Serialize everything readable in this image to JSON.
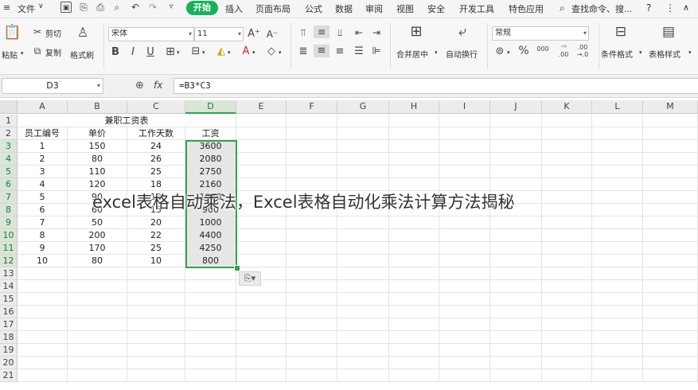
{
  "menubar": {
    "file_label": "文件",
    "tabs": [
      "开始",
      "插入",
      "页面布局",
      "公式",
      "数据",
      "审阅",
      "视图",
      "安全",
      "开发工具",
      "特色应用"
    ],
    "active_tab": "开始",
    "search_label": "查找命令、搜...",
    "help_icon": "?"
  },
  "ribbon": {
    "paste_label": "粘贴",
    "cut_label": "剪切",
    "copy_label": "复制",
    "format_painter_label": "格式刷",
    "font_name": "宋体",
    "font_size": "11",
    "number_format": "常规",
    "merge_center_label": "合并居中",
    "wrap_text_label": "自动换行",
    "conditional_format_label": "条件格式",
    "table_style_label": "表格样式",
    "percent_symbol": "%",
    "thousands_symbol": "000"
  },
  "formula_bar": {
    "name_box": "D3",
    "fx_label": "fx",
    "formula": "=B3*C3"
  },
  "grid": {
    "columns": [
      "A",
      "B",
      "C",
      "D",
      "E",
      "F",
      "G",
      "H",
      "I",
      "J",
      "K",
      "L",
      "M"
    ],
    "selected_column": "D",
    "row_numbers": [
      "1",
      "2",
      "3",
      "4",
      "5",
      "6",
      "7",
      "8",
      "9",
      "10",
      "11",
      "12",
      "13",
      "14",
      "15",
      "16",
      "17",
      "18",
      "19",
      "20",
      "21"
    ],
    "title": "兼职工资表",
    "headers": [
      "员工编号",
      "单价",
      "工作天数",
      "工资"
    ],
    "rows": [
      [
        "1",
        "150",
        "24",
        "3600"
      ],
      [
        "2",
        "80",
        "26",
        "2080"
      ],
      [
        "3",
        "110",
        "25",
        "2750"
      ],
      [
        "4",
        "120",
        "18",
        "2160"
      ],
      [
        "5",
        "90",
        "12",
        "1080"
      ],
      [
        "6",
        "60",
        "15",
        "900"
      ],
      [
        "7",
        "50",
        "20",
        "1000"
      ],
      [
        "8",
        "200",
        "22",
        "4400"
      ],
      [
        "9",
        "170",
        "25",
        "4250"
      ],
      [
        "10",
        "80",
        "10",
        "800"
      ]
    ]
  },
  "overlay_text": "excel表格自动乘法，Excel表格自动化乘法计算方法揭秘",
  "colors": {
    "accent_green": "#2ea44f",
    "tab_active_bg": "#16b25a"
  }
}
